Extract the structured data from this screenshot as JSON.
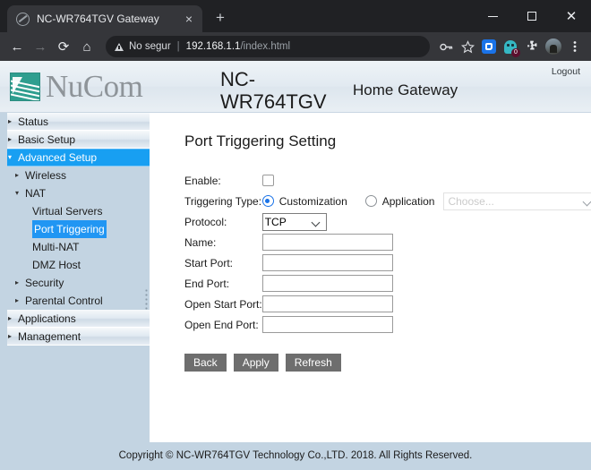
{
  "browser": {
    "tab": {
      "title": "NC-WR764TGV Gateway",
      "favicon": "globe-icon",
      "close": "×"
    },
    "newtab_label": "+",
    "window_controls": {
      "minimize": "minimize-icon",
      "maximize": "maximize-icon",
      "close": "close-icon"
    },
    "nav": {
      "back": "←",
      "forward": "→",
      "reload": "⟳",
      "home": "⌂"
    },
    "omnibox": {
      "security_label": "No segur",
      "separator": "|",
      "url_host": "192.168.1.1",
      "url_path": "/index.html"
    },
    "toolbar_icons": {
      "password": "key-icon",
      "bookmark": "star-icon",
      "extension_grammar": "grammarly-extension-icon",
      "extension_ghostery": "ghostery-extension-icon",
      "ghostery_badge": "0",
      "extensions": "puzzle-icon",
      "profile": "avatar-icon",
      "menu": "kebab-menu-icon"
    }
  },
  "router": {
    "header": {
      "brand": "NuCom",
      "model": "NC-WR764TGV",
      "product": "Home Gateway",
      "logout": "Logout"
    },
    "sidebar": {
      "items": [
        {
          "label": "Status",
          "level": 0,
          "arrow": "▸",
          "state": "collapsed"
        },
        {
          "label": "Basic Setup",
          "level": 0,
          "arrow": "▸",
          "state": "collapsed"
        },
        {
          "label": "Advanced Setup",
          "level": 0,
          "arrow": "▾",
          "state": "expanded-selected"
        },
        {
          "label": "Wireless",
          "level": 1,
          "arrow": "▸",
          "state": "collapsed"
        },
        {
          "label": "NAT",
          "level": 1,
          "arrow": "▾",
          "state": "expanded"
        },
        {
          "label": "Virtual Servers",
          "level": 2,
          "arrow": "",
          "state": "normal"
        },
        {
          "label": "Port Triggering",
          "level": 2,
          "arrow": "",
          "state": "highlighted"
        },
        {
          "label": "Multi-NAT",
          "level": 2,
          "arrow": "",
          "state": "normal"
        },
        {
          "label": "DMZ Host",
          "level": 2,
          "arrow": "",
          "state": "normal"
        },
        {
          "label": "Security",
          "level": 1,
          "arrow": "▸",
          "state": "collapsed"
        },
        {
          "label": "Parental Control",
          "level": 1,
          "arrow": "▸",
          "state": "collapsed"
        },
        {
          "label": "Applications",
          "level": 0,
          "arrow": "▸",
          "state": "collapsed"
        },
        {
          "label": "Management",
          "level": 0,
          "arrow": "▸",
          "state": "collapsed"
        }
      ]
    },
    "main": {
      "title": "Port Triggering Setting",
      "labels": {
        "enable": "Enable:",
        "triggering_type": "Triggering Type:",
        "protocol": "Protocol:",
        "name": "Name:",
        "start_port": "Start Port:",
        "end_port": "End Port:",
        "open_start_port": "Open Start Port:",
        "open_end_port": "Open End Port:"
      },
      "values": {
        "enable_checked": false,
        "triggering_type_selected": "Customization",
        "radio_customization": "Customization",
        "radio_application": "Application",
        "application_select_value": "Choose...",
        "application_select_disabled": true,
        "protocol_value": "TCP",
        "protocol_options": [
          "TCP"
        ],
        "name": "",
        "start_port": "",
        "end_port": "",
        "open_start_port": "",
        "open_end_port": ""
      },
      "buttons": {
        "back": "Back",
        "apply": "Apply",
        "refresh": "Refresh"
      }
    },
    "footer": {
      "copyright": "Copyright © NC-WR764TGV Technology Co.,LTD. 2018. All Rights Reserved."
    }
  },
  "colors": {
    "chrome_dark": "#202124",
    "chrome_tab": "#35363a",
    "sidebar_blue": "#c3d4e2",
    "accent_blue": "#189ff2",
    "selection_blue": "#2196f3",
    "logo_teal": "#2f9e8f",
    "button_grey": "#6e6e6e",
    "radio_blue": "#1a73e8"
  }
}
